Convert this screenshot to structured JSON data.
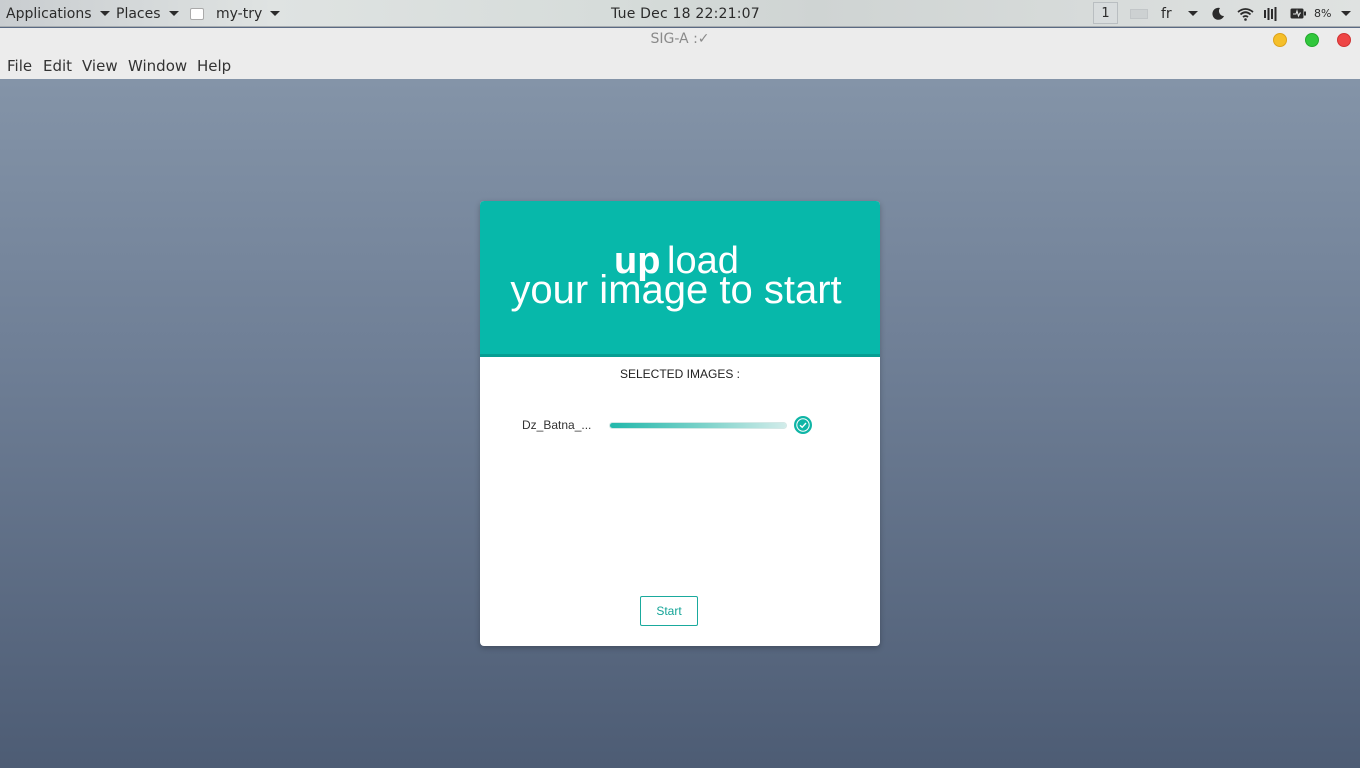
{
  "top_panel": {
    "applications": "Applications",
    "places": "Places",
    "active_app": "my-try",
    "clock": "Tue Dec 18  22:21:07",
    "workspace": "1",
    "keyboard_layout": "fr",
    "battery": "8%"
  },
  "window": {
    "title": "SIG-A :✓",
    "buttons": {
      "minimize_color": "#f5bf2a",
      "maximize_color": "#31c73c",
      "close_color": "#ee4646"
    }
  },
  "menu": {
    "file": "File",
    "edit": "Edit",
    "view": "View",
    "window": "Window",
    "help": "Help"
  },
  "card": {
    "header_dot": ".",
    "header_up": "up",
    "header_load": "load",
    "header_line2": "your image to start",
    "selected_label": "SELECTED IMAGES :",
    "file_name": "Dz_Batna_...",
    "upload_progress": 1.0,
    "start_button": "Start",
    "accent_color": "#07b8aa"
  }
}
